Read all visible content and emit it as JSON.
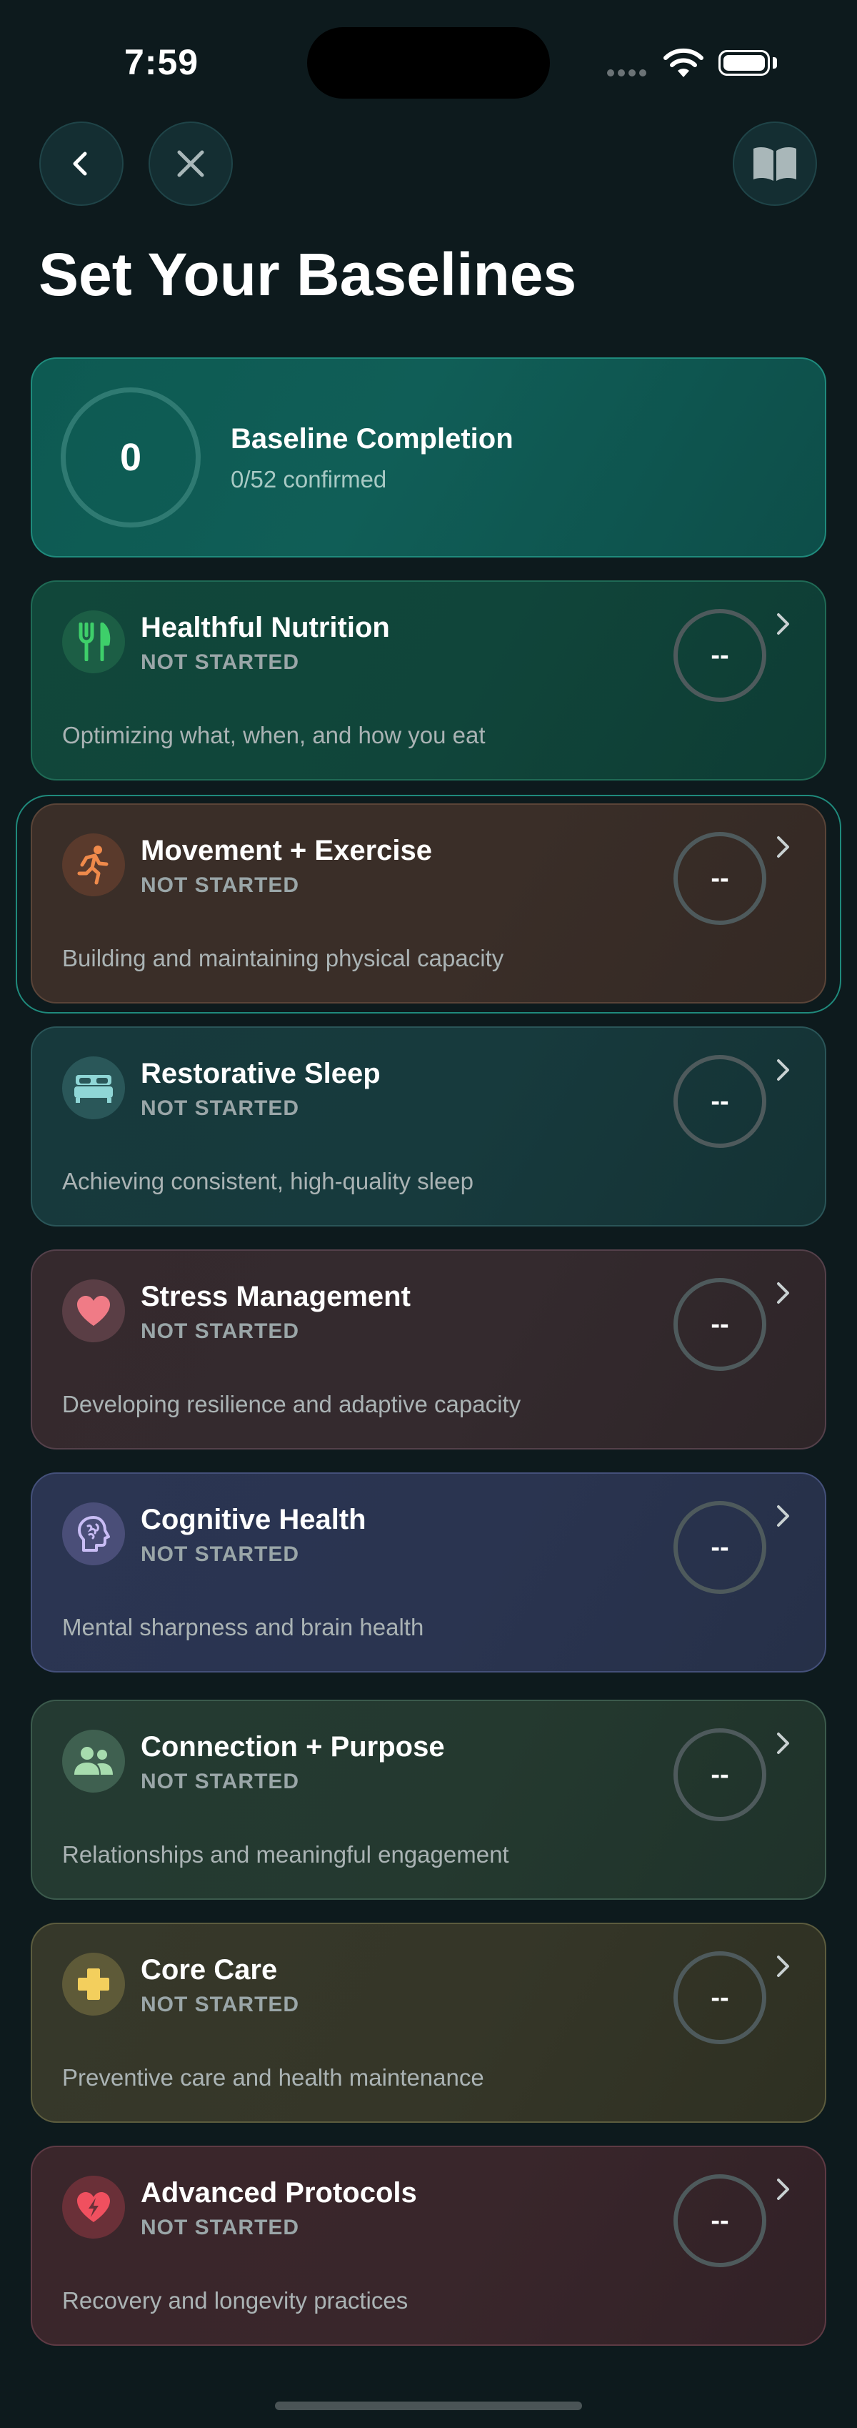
{
  "status_bar": {
    "time": "7:59"
  },
  "header": {
    "title": "Set Your Baselines",
    "back_icon": "chevron-left-icon",
    "close_icon": "close-icon",
    "guide_icon": "book-icon"
  },
  "summary": {
    "count": "0",
    "title": "Baseline Completion",
    "subtitle": "0/52 confirmed",
    "progress": 0
  },
  "categories": [
    {
      "name": "Healthful Nutrition",
      "status": "NOT STARTED",
      "description": "Optimizing what, when, and how you eat",
      "score": "--",
      "icon": "fork-knife-icon",
      "accent": "#3ecf6a"
    },
    {
      "name": "Movement + Exercise",
      "status": "NOT STARTED",
      "description": "Building and maintaining physical capacity",
      "score": "--",
      "icon": "running-icon",
      "accent": "#f08a4b",
      "selected": true
    },
    {
      "name": "Restorative Sleep",
      "status": "NOT STARTED",
      "description": "Achieving consistent, high-quality sleep",
      "score": "--",
      "icon": "bed-icon",
      "accent": "#8fd6d6"
    },
    {
      "name": "Stress Management",
      "status": "NOT STARTED",
      "description": "Developing resilience and adaptive capacity",
      "score": "--",
      "icon": "heart-icon",
      "accent": "#f07b86"
    },
    {
      "name": "Cognitive Health",
      "status": "NOT STARTED",
      "description": "Mental sharpness and brain health",
      "score": "--",
      "icon": "brain-icon",
      "accent": "#b9a6f2"
    },
    {
      "name": "Connection + Purpose",
      "status": "NOT STARTED",
      "description": "Relationships and meaningful engagement",
      "score": "--",
      "icon": "people-icon",
      "accent": "#a7dcae"
    },
    {
      "name": "Core Care",
      "status": "NOT STARTED",
      "description": "Preventive care and health maintenance",
      "score": "--",
      "icon": "medical-cross-icon",
      "accent": "#f3cf5d"
    },
    {
      "name": "Advanced Protocols",
      "status": "NOT STARTED",
      "description": "Recovery and longevity practices",
      "score": "--",
      "icon": "heart-bolt-icon",
      "accent": "#f0505f"
    }
  ]
}
